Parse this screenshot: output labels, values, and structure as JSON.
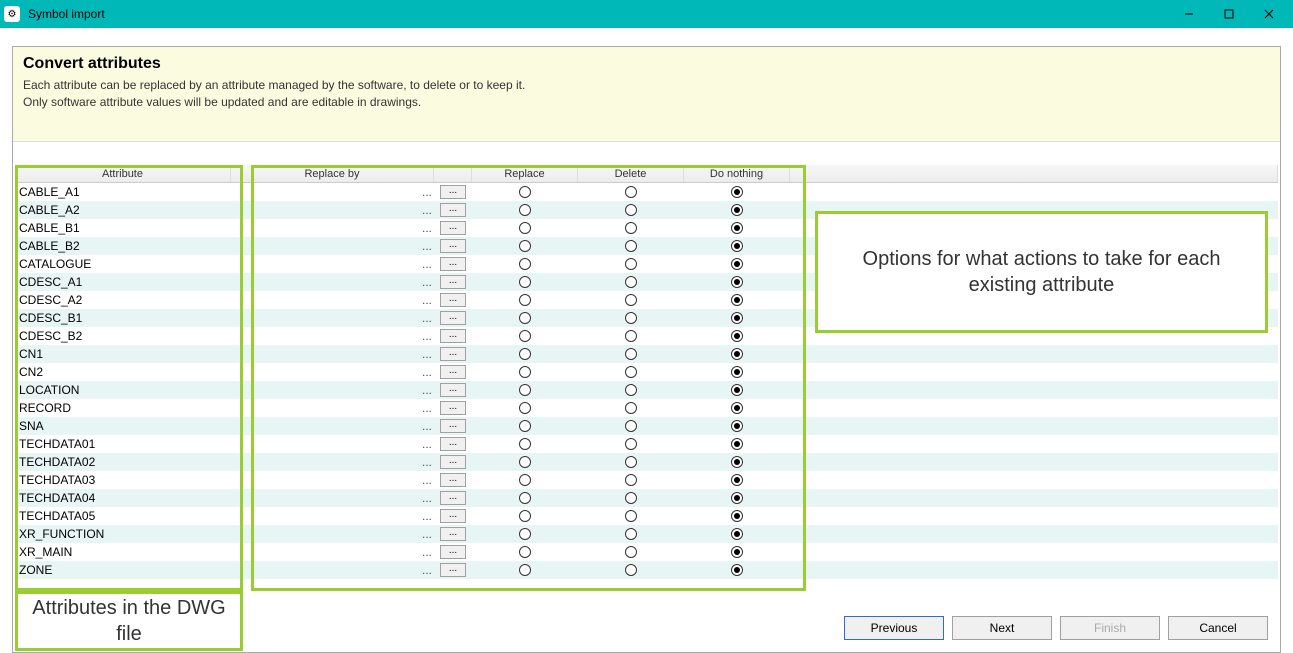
{
  "window": {
    "title": "Symbol import"
  },
  "header": {
    "title": "Convert attributes",
    "line1": "Each attribute can be replaced by an attribute managed by the software, to delete or to keep it.",
    "line2": "Only software attribute values will be updated and are editable in drawings."
  },
  "columns": {
    "attribute": "Attribute",
    "replace_by": "Replace by",
    "picker": "",
    "replace": "Replace",
    "delete": "Delete",
    "do_nothing": "Do nothing"
  },
  "rows": [
    {
      "attr": "CABLE_A1",
      "replace_by": "...",
      "selected": "do_nothing"
    },
    {
      "attr": "CABLE_A2",
      "replace_by": "...",
      "selected": "do_nothing"
    },
    {
      "attr": "CABLE_B1",
      "replace_by": "...",
      "selected": "do_nothing"
    },
    {
      "attr": "CABLE_B2",
      "replace_by": "...",
      "selected": "do_nothing"
    },
    {
      "attr": "CATALOGUE",
      "replace_by": "...",
      "selected": "do_nothing"
    },
    {
      "attr": "CDESC_A1",
      "replace_by": "...",
      "selected": "do_nothing"
    },
    {
      "attr": "CDESC_A2",
      "replace_by": "...",
      "selected": "do_nothing"
    },
    {
      "attr": "CDESC_B1",
      "replace_by": "...",
      "selected": "do_nothing"
    },
    {
      "attr": "CDESC_B2",
      "replace_by": "...",
      "selected": "do_nothing"
    },
    {
      "attr": "CN1",
      "replace_by": "...",
      "selected": "do_nothing"
    },
    {
      "attr": "CN2",
      "replace_by": "...",
      "selected": "do_nothing"
    },
    {
      "attr": "LOCATION",
      "replace_by": "...",
      "selected": "do_nothing"
    },
    {
      "attr": "RECORD",
      "replace_by": "...",
      "selected": "do_nothing"
    },
    {
      "attr": "SNA",
      "replace_by": "...",
      "selected": "do_nothing"
    },
    {
      "attr": "TECHDATA01",
      "replace_by": "...",
      "selected": "do_nothing"
    },
    {
      "attr": "TECHDATA02",
      "replace_by": "...",
      "selected": "do_nothing"
    },
    {
      "attr": "TECHDATA03",
      "replace_by": "...",
      "selected": "do_nothing"
    },
    {
      "attr": "TECHDATA04",
      "replace_by": "...",
      "selected": "do_nothing"
    },
    {
      "attr": "TECHDATA05",
      "replace_by": "...",
      "selected": "do_nothing"
    },
    {
      "attr": "XR_FUNCTION",
      "replace_by": "...",
      "selected": "do_nothing"
    },
    {
      "attr": "XR_MAIN",
      "replace_by": "...",
      "selected": "do_nothing"
    },
    {
      "attr": "ZONE",
      "replace_by": "...",
      "selected": "do_nothing"
    }
  ],
  "picker_button_label": "...",
  "callouts": {
    "right": "Options for what actions to take for each existing attribute",
    "bottom": "Attributes in the DWG file"
  },
  "footer": {
    "previous": "Previous",
    "next": "Next",
    "finish": "Finish",
    "cancel": "Cancel"
  }
}
